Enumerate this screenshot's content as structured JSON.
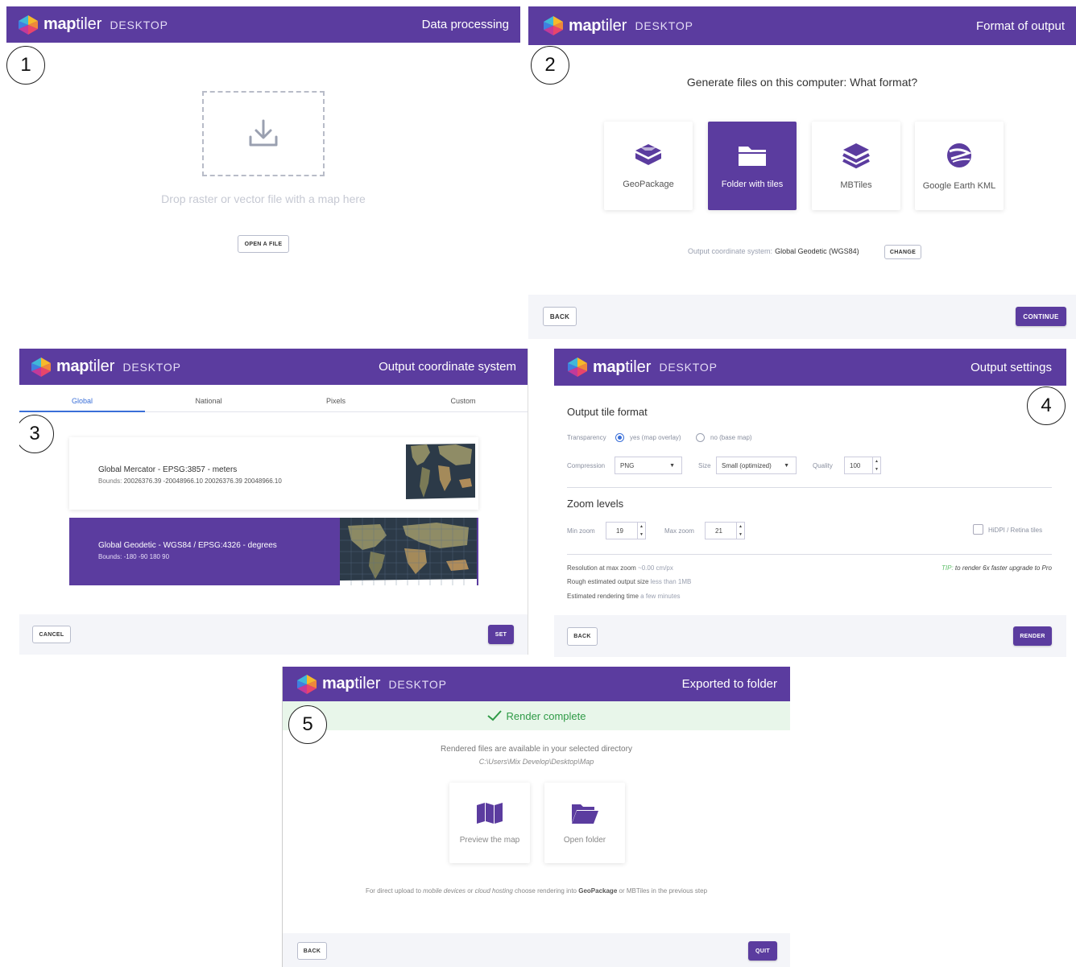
{
  "brand": {
    "map": "map",
    "tiler": "tiler",
    "desktop": "DESKTOP"
  },
  "colors": {
    "accent": "#5b3c9f",
    "success": "#2e9a46",
    "success_bg": "#e8f6ea"
  },
  "panel1": {
    "step": "1",
    "title": "Data processing",
    "drop_text": "Drop raster or vector file with a map here",
    "open_button": "OPEN A FILE"
  },
  "panel2": {
    "step": "2",
    "title": "Format of output",
    "question": "Generate files on this computer: What format?",
    "formats": [
      {
        "label": "GeoPackage",
        "icon": "geopackage-icon",
        "selected": false
      },
      {
        "label": "Folder with tiles",
        "icon": "folder-icon",
        "selected": true
      },
      {
        "label": "MBTiles",
        "icon": "layers-icon",
        "selected": false
      },
      {
        "label": "Google Earth KML",
        "icon": "globe-icon",
        "selected": false
      }
    ],
    "coord_label": "Output coordinate system:",
    "coord_value": "Global Geodetic (WGS84)",
    "change_button": "CHANGE",
    "back_button": "BACK",
    "continue_button": "CONTINUE"
  },
  "panel3": {
    "step": "3",
    "title": "Output coordinate system",
    "tabs": [
      "Global",
      "National",
      "Pixels",
      "Custom"
    ],
    "active_tab": "Global",
    "options": [
      {
        "name": "Global Mercator - EPSG:3857 - meters",
        "bounds_label": "Bounds:",
        "bounds": "20026376.39 -20048966.10 20026376.39 20048966.10",
        "selected": false
      },
      {
        "name": "Global Geodetic - WGS84 / EPSG:4326 - degrees",
        "bounds_label": "Bounds:",
        "bounds": "-180 -90 180 90",
        "selected": true
      }
    ],
    "cancel_button": "CANCEL",
    "set_button": "SET"
  },
  "panel4": {
    "step": "4",
    "title": "Output settings",
    "tile_format_title": "Output tile format",
    "transparency_label": "Transparency",
    "transparency_yes": "yes (map overlay)",
    "transparency_no": "no (base map)",
    "compression_label": "Compression",
    "compression_value": "PNG",
    "size_label": "Size",
    "size_value": "Small (optimized)",
    "quality_label": "Quality",
    "quality_value": "100",
    "zoom_title": "Zoom levels",
    "min_zoom_label": "Min zoom",
    "min_zoom_value": "19",
    "max_zoom_label": "Max zoom",
    "max_zoom_value": "21",
    "hidpi_label": "HiDPI / Retina tiles",
    "resolution_label": "Resolution at max zoom",
    "resolution_value": "~0.00 cm/px",
    "size_est_label": "Rough estimated output size",
    "size_est_value": "less than 1MB",
    "time_label": "Estimated rendering time",
    "time_value": "a few minutes",
    "tip_prefix": "TIP:",
    "tip_text": "to render 6x faster upgrade to Pro",
    "back_button": "BACK",
    "render_button": "RENDER"
  },
  "panel5": {
    "step": "5",
    "title": "Exported to folder",
    "complete_text": "Render complete",
    "available_text": "Rendered files are available in your selected directory",
    "path": "C:\\Users\\Mix Develop\\Desktop\\Map",
    "actions": [
      {
        "label": "Preview the map",
        "icon": "map-icon"
      },
      {
        "label": "Open folder",
        "icon": "folder-open-icon"
      }
    ],
    "hint_1": "For direct upload to",
    "hint_2": "mobile devices",
    "hint_3": "or",
    "hint_4": "cloud hosting",
    "hint_5": "choose rendering into",
    "hint_6": "GeoPackage",
    "hint_7": "or MBTiles in the previous step",
    "back_button": "BACK",
    "quit_button": "QUIT"
  }
}
